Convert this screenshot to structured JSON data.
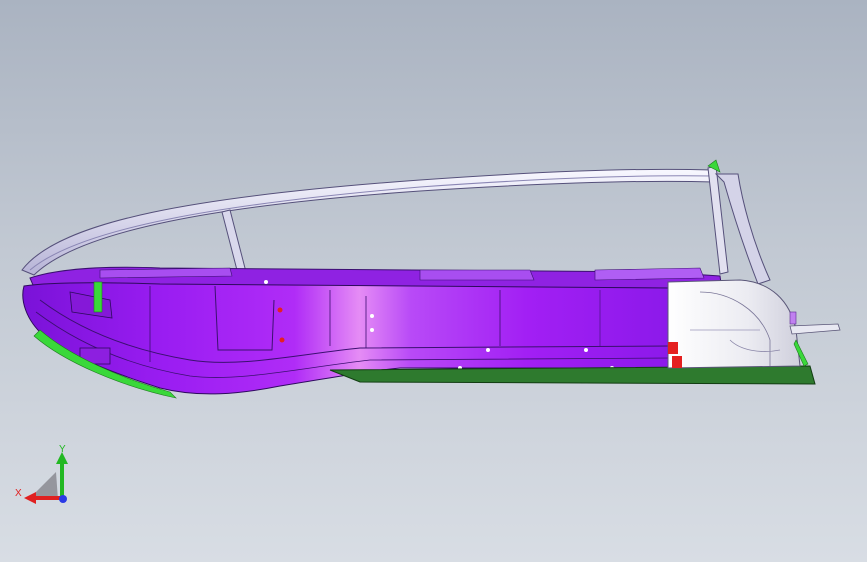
{
  "viewport": {
    "background_top": "#aab3c1",
    "background_bottom": "#d8dde4"
  },
  "model": {
    "body_color": "#9a1df2",
    "highlight_color": "#e58cf5",
    "frame_color": "#ececf6",
    "rear_color": "#f4f4f8",
    "floor_color": "#2e7a2e",
    "accent_green": "#3ad83a",
    "accent_red": "#e52020"
  },
  "triad": {
    "x_label": "X",
    "y_label": "Y",
    "x_color": "#e02020",
    "y_color": "#22b822",
    "z_color": "#2a3ae6",
    "icon": "coordinate-triad-icon"
  }
}
